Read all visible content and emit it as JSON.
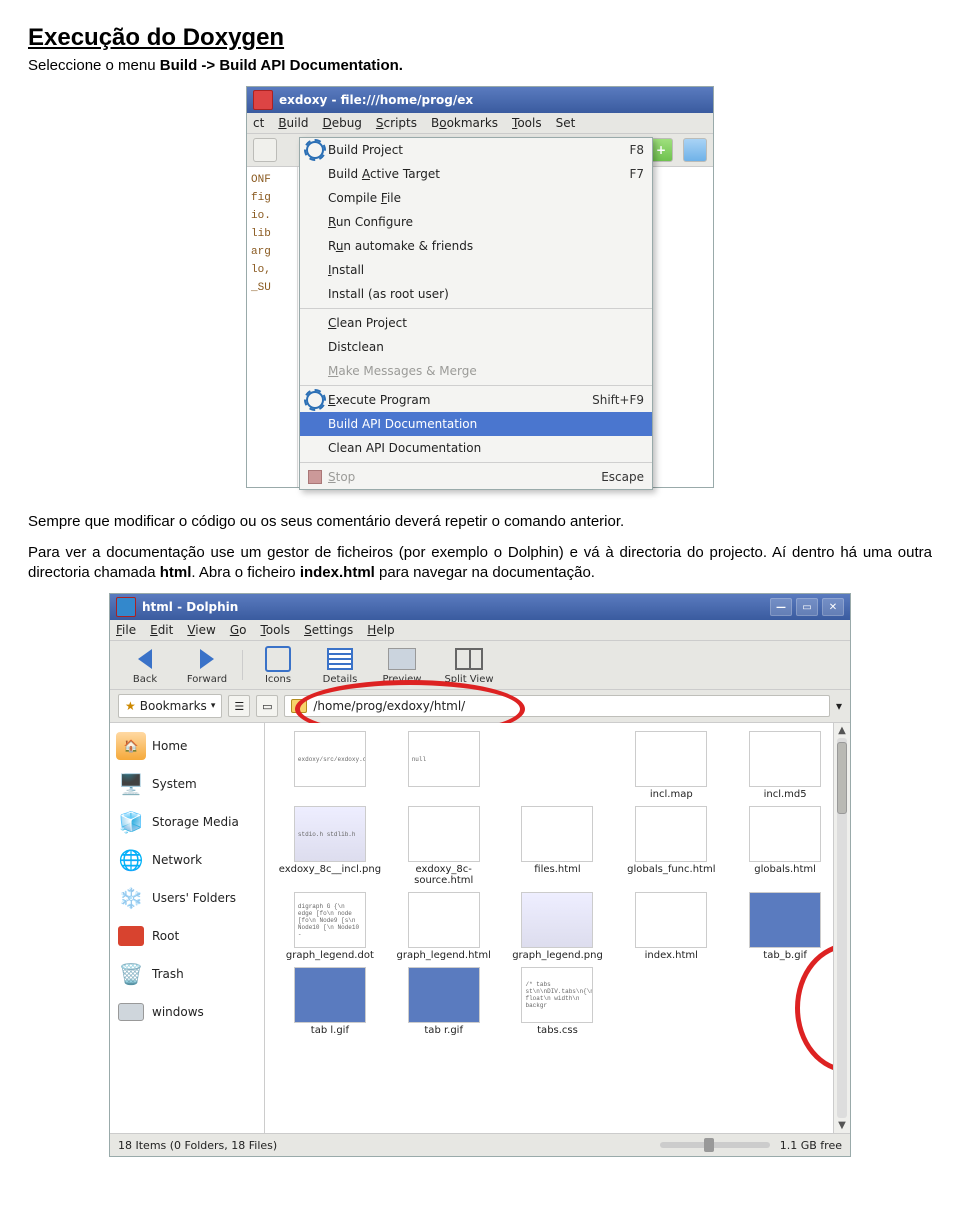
{
  "doc": {
    "heading": "Execução do Doxygen",
    "intro_1a": "Seleccione o menu ",
    "intro_1b": "Build -> Build API Documentation.",
    "para2": "Sempre que modificar o código ou os seus comentário deverá repetir o comando anterior.",
    "para3a": "Para ver a documentação use um gestor de ficheiros (por exemplo o Dolphin) e vá à directoria do projecto. Aí dentro há uma outra directoria chamada ",
    "para3b": "html",
    "para3c": ". Abra o ficheiro ",
    "para3d": "index.html",
    "para3e": " para navegar na documentação."
  },
  "fig1": {
    "title": "exdoxy - file:///home/prog/ex",
    "menus": [
      "ct",
      "Build",
      "Debug",
      "Scripts",
      "Bookmarks",
      "Tools",
      "Set"
    ],
    "left": [
      "",
      "ONF",
      "fig",
      "",
      "io.",
      "lib",
      "",
      "arg",
      "",
      "lo,",
      "",
      "_SU",
      ""
    ],
    "items": [
      {
        "label": "Build Project",
        "shortcut": "F8",
        "icon": "gear"
      },
      {
        "label": "Build Active Target",
        "shortcut": "F7"
      },
      {
        "label": "Compile File"
      },
      {
        "label": "Run Configure"
      },
      {
        "label": "Run automake & friends"
      },
      {
        "label": "Install"
      },
      {
        "label": "Install (as root user)"
      },
      {
        "sep": true
      },
      {
        "label": "Clean Project"
      },
      {
        "label": "Distclean"
      },
      {
        "label": "Make Messages & Merge",
        "disabled": true
      },
      {
        "sep": true
      },
      {
        "label": "Execute Program",
        "shortcut": "Shift+F9",
        "icon": "gear"
      },
      {
        "label": "Build API Documentation",
        "highlight": true
      },
      {
        "label": "Clean API Documentation"
      },
      {
        "sep": true
      },
      {
        "label": "Stop",
        "shortcut": "Escape",
        "disabled": true,
        "icon": "stop"
      }
    ]
  },
  "fig2": {
    "title": "html - Dolphin",
    "menus": [
      "File",
      "Edit",
      "View",
      "Go",
      "Tools",
      "Settings",
      "Help"
    ],
    "toolbar": [
      "Back",
      "Forward",
      "Icons",
      "Details",
      "Preview",
      "Split View"
    ],
    "bookmarks_label": "Bookmarks",
    "path": "/home/prog/exdoxy/html/",
    "places": [
      "Home",
      "System",
      "Storage Media",
      "Network",
      "Users' Folders",
      "Root",
      "Trash",
      "windows"
    ],
    "files_row1": [
      {
        "name": "",
        "txt": "exdoxy/src/exdoxy.c"
      },
      {
        "name": "",
        "txt": "null"
      },
      {
        "name": "incl.map",
        "txt": ""
      },
      {
        "name": "incl.md5",
        "txt": ""
      }
    ],
    "files_row2": [
      {
        "name": "exdoxy_8c__incl.png",
        "txt": "stdio.h   stdlib.h"
      },
      {
        "name": "exdoxy_8c-source.html",
        "txt": ""
      },
      {
        "name": "files.html",
        "txt": ""
      },
      {
        "name": "globals_func.html",
        "txt": ""
      },
      {
        "name": "globals.html",
        "txt": ""
      }
    ],
    "files_row3": [
      {
        "name": "graph_legend.dot",
        "txt": "digraph G {\\n edge [fo\\n node [fo\\n Node9 [s\\n Node10 [\\n Node10 -"
      },
      {
        "name": "graph_legend.html",
        "txt": ""
      },
      {
        "name": "graph_legend.png",
        "txt": ""
      },
      {
        "name": "index.html",
        "txt": ""
      },
      {
        "name": "tab_b.gif",
        "txt": ""
      }
    ],
    "files_row4": [
      {
        "name": "tab l.gif",
        "txt": ""
      },
      {
        "name": "tab r.gif",
        "txt": ""
      },
      {
        "name": "tabs.css",
        "txt": "/* tabs st\\n\\nDIV.tabs\\n{\\n float\\n width\\n backgr"
      }
    ],
    "status_left": "18 Items (0 Folders, 18 Files)",
    "status_right": "1.1 GB free"
  }
}
